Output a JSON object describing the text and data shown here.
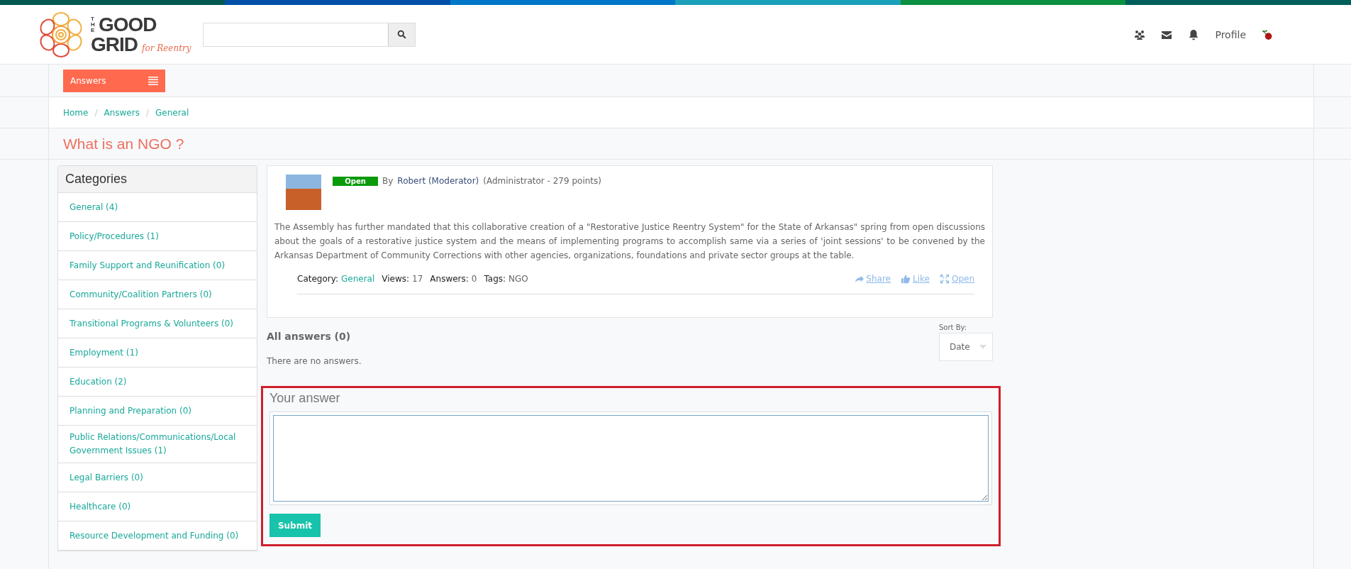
{
  "logo": {
    "the": "THE",
    "line1": "GOOD",
    "line2": "GRID",
    "tagline": "for Reentry"
  },
  "header": {
    "profile": "Profile"
  },
  "section_button": {
    "label": "Answers"
  },
  "breadcrumb": [
    "Home",
    "Answers",
    "General"
  ],
  "breadcrumb_separator": "/",
  "page_title": "What is an NGO ?",
  "categories": {
    "title": "Categories",
    "items": [
      {
        "label": "General (4)"
      },
      {
        "label": "Policy/Procedures (1)"
      },
      {
        "label": "Family Support and Reunification (0)"
      },
      {
        "label": "Community/Coalition Partners (0)"
      },
      {
        "label": "Transitional Programs & Volunteers (0)"
      },
      {
        "label": "Employment (1)"
      },
      {
        "label": "Education (2)"
      },
      {
        "label": "Planning and Preparation (0)"
      },
      {
        "label": "Public Relations/Communications/Local Government Issues (1)"
      },
      {
        "label": "Legal Barriers (0)"
      },
      {
        "label": "Healthcare (0)"
      },
      {
        "label": "Resource Development and Funding (0)"
      }
    ]
  },
  "question": {
    "status": "Open",
    "by": "By",
    "author": "Robert (Moderator)",
    "role": "(Administrator - 279 points)",
    "body": "The Assembly has further mandated that this collaborative creation of a \"Restorative Justice Reentry System\" for the State of Arkansas\" spring from open discussions about the goals of a restorative justice system and the means of implementing programs to accomplish same via a series of 'joint sessions' to be convened by the Arkansas Department of Community Corrections with other agencies, organizations, foundations and private sector groups at the table.",
    "meta": [
      {
        "label": "Category:",
        "value": "General",
        "kind": "link"
      },
      {
        "label": "Views:",
        "value": "17",
        "kind": "text"
      },
      {
        "label": "Answers:",
        "value": "0",
        "kind": "text"
      },
      {
        "label": "Tags:",
        "value": "NGO",
        "kind": "text"
      }
    ],
    "actions": [
      {
        "label": "Share",
        "kind": "share"
      },
      {
        "label": "Like",
        "kind": "like"
      },
      {
        "label": "Open",
        "kind": "expand"
      }
    ]
  },
  "answers": {
    "title": "All answers (0)",
    "sort_label": "Sort By:",
    "sort_value": "Date",
    "empty": "There are no answers."
  },
  "answer_form": {
    "title": "Your answer",
    "submit": "Submit"
  }
}
